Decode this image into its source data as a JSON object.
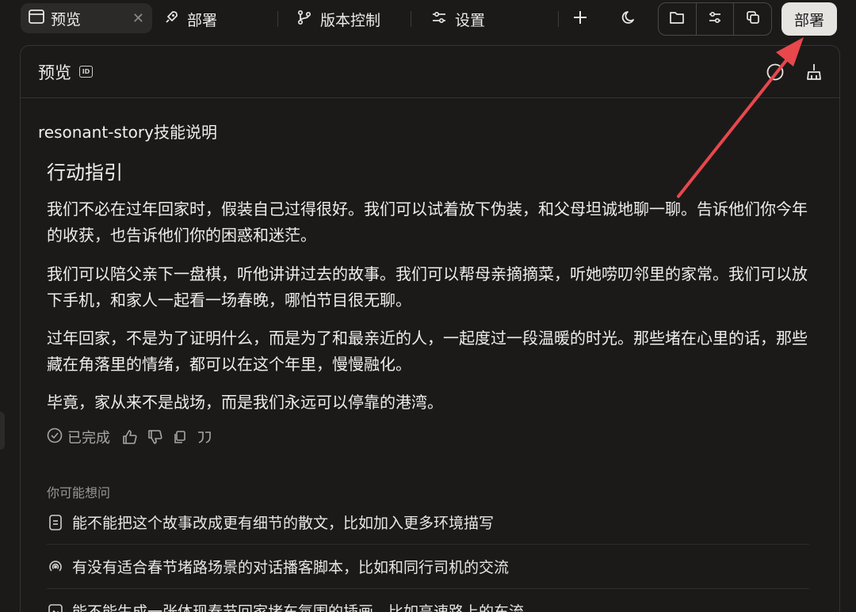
{
  "toolbar": {
    "tabs": [
      {
        "label": "预览",
        "icon": "browser-window-icon",
        "active": true
      },
      {
        "label": "部署",
        "icon": "rocket-icon"
      },
      {
        "label": "版本控制",
        "icon": "git-branch-icon"
      },
      {
        "label": "设置",
        "icon": "sliders-icon"
      }
    ],
    "close_glyph": "✕",
    "deploy_label": "部署"
  },
  "panel": {
    "title": "预览",
    "id_badge": "ID",
    "doc_title": "resonant-story技能说明",
    "section_heading": "行动指引",
    "paragraphs": [
      "我们不必在过年回家时，假装自己过得很好。我们可以试着放下伪装，和父母坦诚地聊一聊。告诉他们你今年的收获，也告诉他们你的困惑和迷茫。",
      "我们可以陪父亲下一盘棋，听他讲讲过去的故事。我们可以帮母亲摘摘菜，听她唠叨邻里的家常。我们可以放下手机，和家人一起看一场春晚，哪怕节目很无聊。",
      "过年回家，不是为了证明什么，而是为了和最亲近的人，一起度过一段温暖的时光。那些堵在心里的话，那些藏在角落里的情绪，都可以在这个年里，慢慢融化。",
      "毕竟，家从来不是战场，而是我们永远可以停靠的港湾。"
    ],
    "status_label": "已完成",
    "suggest_heading": "你可能想问",
    "suggestions": [
      {
        "text": "能不能把这个故事改成更有细节的散文，比如加入更多环境描写",
        "icon": "document-icon"
      },
      {
        "text": "有没有适合春节堵路场景的对话播客脚本，比如和同行司机的交流",
        "icon": "podcast-icon"
      },
      {
        "text": "能不能生成一张体现春节回家堵车氛围的插画，比如高速路上的车流",
        "icon": "image-icon"
      }
    ]
  },
  "colors": {
    "background": "#1b1a19",
    "accent_arrow": "#e8474c",
    "deploy_button_bg": "#e5e4e1"
  }
}
